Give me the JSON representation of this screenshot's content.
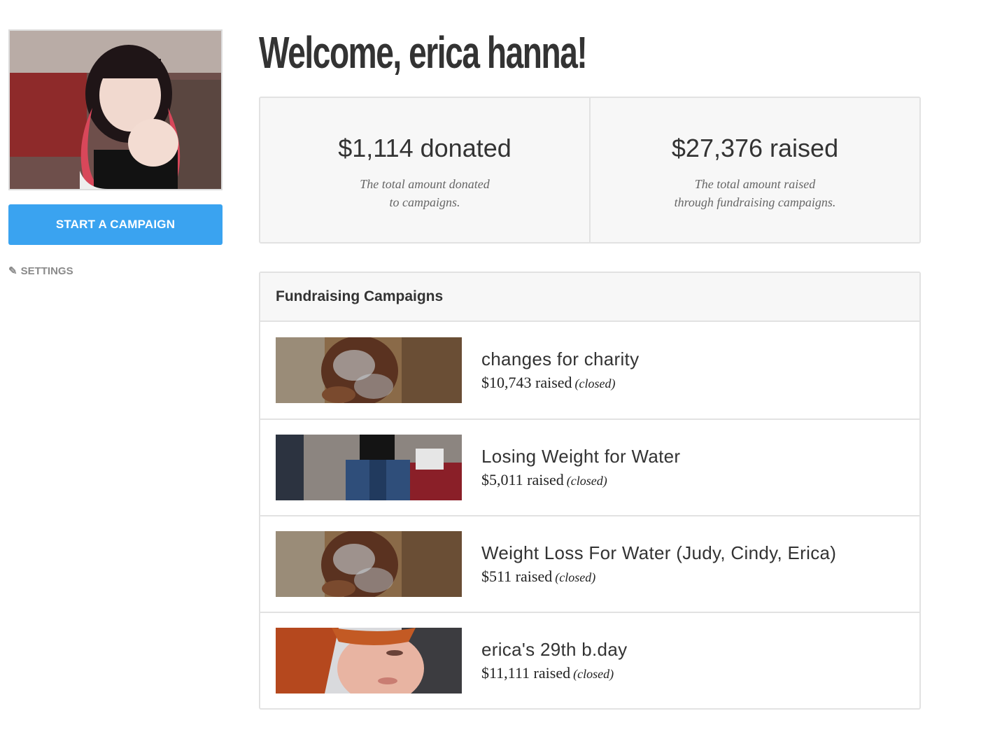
{
  "sidebar": {
    "start_button_label": "START A CAMPAIGN",
    "settings_label": "SETTINGS",
    "settings_icon": "pencil-icon"
  },
  "main": {
    "welcome": "Welcome, erica hanna!",
    "stats": [
      {
        "value": "$1,114 donated",
        "desc_line1": "The total amount donated",
        "desc_line2": "to campaigns."
      },
      {
        "value": "$27,376 raised",
        "desc_line1": "The total amount raised",
        "desc_line2": "through fundraising campaigns."
      }
    ],
    "campaigns": {
      "header": "Fundraising Campaigns",
      "items": [
        {
          "title": "changes for charity",
          "raised": "$10,743 raised",
          "status": "(closed)"
        },
        {
          "title": "Losing Weight for Water",
          "raised": "$5,011 raised",
          "status": "(closed)"
        },
        {
          "title": "Weight Loss For Water (Judy, Cindy, Erica)",
          "raised": "$511 raised",
          "status": "(closed)"
        },
        {
          "title": "erica's 29th b.day",
          "raised": "$11,111 raised",
          "status": "(closed)"
        }
      ]
    }
  },
  "colors": {
    "accent": "#3aa3f0",
    "panel_bg": "#f7f7f7",
    "border": "#e2e2e2",
    "text": "#333333",
    "muted": "#8a8a8a"
  }
}
